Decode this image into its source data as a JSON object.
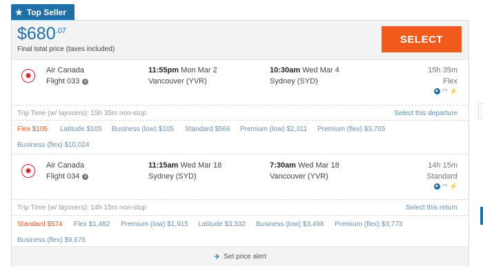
{
  "badge": {
    "label": "Top Seller",
    "icon": "star-icon"
  },
  "price": {
    "main": "$680",
    "cents": ".07",
    "subtitle": "Final total price (taxes included)"
  },
  "select_label": "SELECT",
  "departure": {
    "airline": "Air Canada",
    "flight": "Flight 033",
    "depart_time": "11:55pm",
    "depart_date": "Mon Mar 2",
    "depart_city": "Vancouver (YVR)",
    "arrive_time": "10:30am",
    "arrive_date": "Wed Mar 4",
    "arrive_city": "Sydney (SYD)",
    "duration": "15h 35m",
    "fare_class": "Flex",
    "trip_time": "Trip Time (w/ layovers): 15h 35m non-stop",
    "select_link": "Select this departure",
    "fares": [
      "Flex $105",
      "Latitude $105",
      "Business (low) $105",
      "Standard $566",
      "Premium (low) $2,311",
      "Premium (flex) $3,765",
      "Business (flex) $10,024"
    ]
  },
  "return": {
    "airline": "Air Canada",
    "flight": "Flight 034",
    "depart_time": "11:15am",
    "depart_date": "Wed Mar 18",
    "depart_city": "Sydney (SYD)",
    "arrive_time": "7:30am",
    "arrive_date": "Wed Mar 18",
    "arrive_city": "Vancouver (YVR)",
    "duration": "14h 15m",
    "fare_class": "Standard",
    "trip_time": "Trip Time (w/ layovers): 14h 15m non-stop",
    "select_link": "Select this return",
    "fares": [
      "Standard $574",
      "Flex $1,482",
      "Premium (low) $1,915",
      "Latitude $3,332",
      "Business (low) $3,498",
      "Premium (flex) $3,773",
      "Business (flex) $9,676"
    ]
  },
  "price_alert": "Set price alert",
  "colors": {
    "brand_blue": "#1f6fa8",
    "select_orange": "#f05a1a",
    "active_fare": "#e8522a",
    "fare_link": "#6b8fb0"
  }
}
